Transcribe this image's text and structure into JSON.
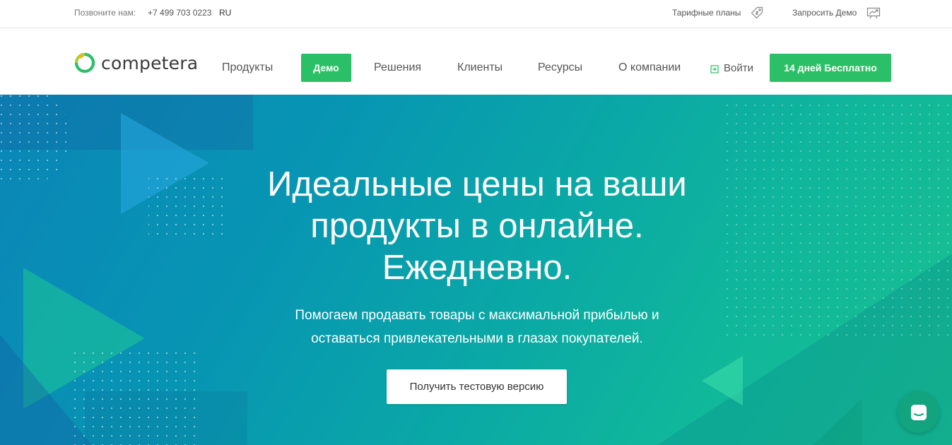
{
  "topbar": {
    "phone_label": "Позвоните нам:",
    "phone": "+7 499 703 0223",
    "lang": "RU",
    "tariffs": "Тарифные планы",
    "tariffs_icon": "price-tag-icon",
    "demo_request": "Запросить Демо",
    "demo_icon": "chart-presentation-icon"
  },
  "navbar": {
    "logo_text": "competera",
    "items": [
      {
        "label": "Продукты"
      },
      {
        "label": "Демо"
      },
      {
        "label": "Решения"
      },
      {
        "label": "Клиенты"
      },
      {
        "label": "Ресурсы"
      },
      {
        "label": "О компании"
      }
    ],
    "login": "Войти",
    "login_icon": "sign-in-icon",
    "trial": "14 дней Бесплатно"
  },
  "hero": {
    "title_line1": "Идеальные цены на ваши",
    "title_line2": "продукты в онлайне.",
    "title_line3": "Ежедневно.",
    "subtitle_line1": "Помогаем продавать товары с максимальной прибылью и",
    "subtitle_line2": "оставаться привлекательными в глазах покупателей.",
    "cta": "Получить тестовую версию"
  },
  "chat": {
    "icon": "chat-icon"
  },
  "colors": {
    "accent_green": "#2bc067",
    "hero_start": "#0a86b8",
    "hero_end": "#19c08f",
    "chat_bg": "#11a47e"
  }
}
